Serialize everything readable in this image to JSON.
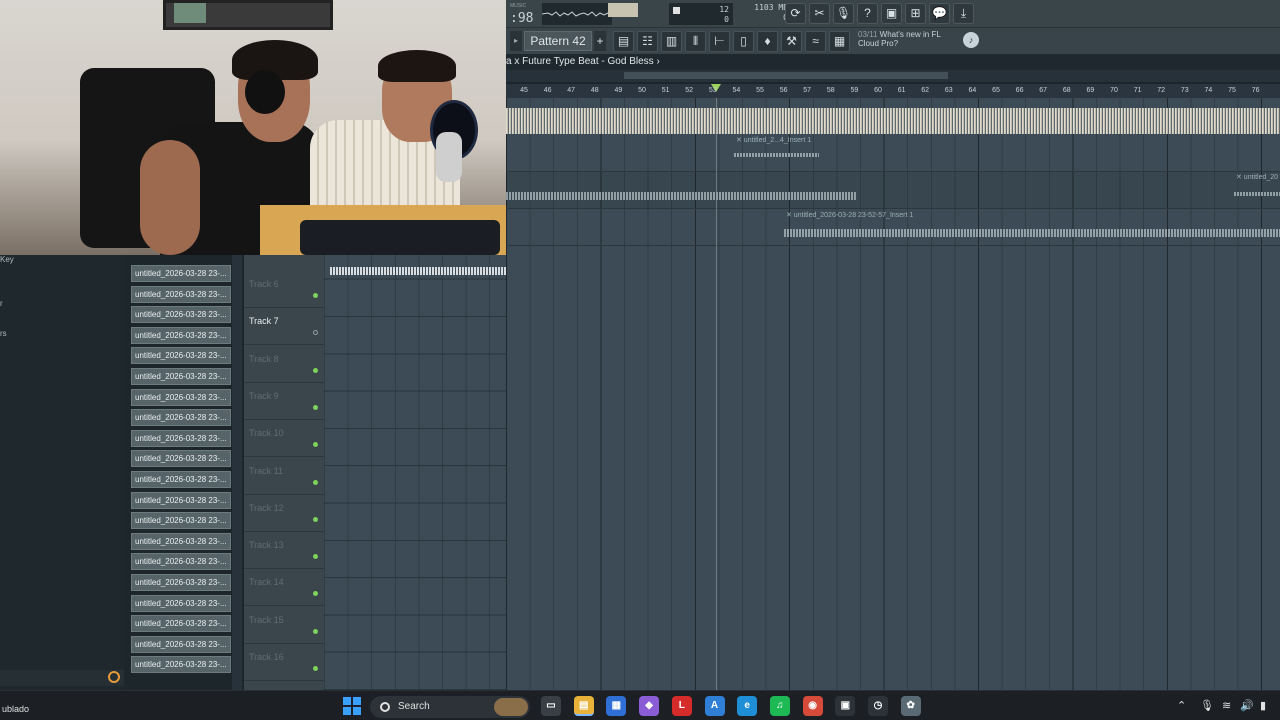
{
  "toolbar": {
    "tempo_label": "MUSIC",
    "tempo_value": ":98",
    "position_top": "12",
    "position_bottom": "0",
    "memory_top": "1103 MB",
    "memory_bottom": "0",
    "buttons": [
      {
        "icon": "loop-icon",
        "glyph": "⟳"
      },
      {
        "icon": "cut-icon",
        "glyph": "✂"
      },
      {
        "icon": "mic-icon",
        "glyph": "🎙"
      },
      {
        "icon": "help-icon",
        "glyph": "?"
      },
      {
        "icon": "save-icon",
        "glyph": "▣"
      },
      {
        "icon": "mixer-icon",
        "glyph": "⊞"
      },
      {
        "icon": "chat-icon",
        "glyph": "💬"
      },
      {
        "icon": "download-icon",
        "glyph": "⤓"
      }
    ]
  },
  "toolbar2": {
    "pattern_label": "Pattern 42",
    "add_glyph": "+",
    "play_glyph": "▸",
    "news_count": "03/11",
    "news_text_1": "What's new in FL",
    "news_text_2": "Cloud Pro?",
    "news_icon_glyph": "♪"
  },
  "playlist": {
    "title": "a x Future Type Beat - God Bless",
    "title_arrow": "›",
    "ruler_ticks": [
      "45",
      "46",
      "47",
      "48",
      "49",
      "50",
      "51",
      "52",
      "53",
      "54",
      "55",
      "56",
      "57",
      "58",
      "59",
      "60",
      "61",
      "62",
      "63",
      "64",
      "65",
      "66",
      "67",
      "68",
      "69",
      "70",
      "71",
      "72",
      "73",
      "74",
      "75",
      "76"
    ],
    "clip_labels": {
      "lane2": "✕ untitled_2...4_Insert 1",
      "lane3_right": "✕ untitled_20",
      "lane4": "✕ untitled_2026-03-28 23-52-57_Insert 1"
    }
  },
  "browser": {
    "labels": [
      "Key",
      "r",
      "rs"
    ],
    "search_icon": "search-icon"
  },
  "clip_list": {
    "items": [
      "untitled_2026-03-28 23-...",
      "untitled_2026-03-28 23-...",
      "untitled_2026-03-28 23-...",
      "untitled_2026-03-28 23-...",
      "untitled_2026-03-28 23-...",
      "untitled_2026-03-28 23-...",
      "untitled_2026-03-28 23-...",
      "untitled_2026-03-28 23-...",
      "untitled_2026-03-28 23-...",
      "untitled_2026-03-28 23-...",
      "untitled_2026-03-28 23-...",
      "untitled_2026-03-28 23-...",
      "untitled_2026-03-28 23-...",
      "untitled_2026-03-28 23-...",
      "untitled_2026-03-28 23-...",
      "untitled_2026-03-28 23-...",
      "untitled_2026-03-28 23-...",
      "untitled_2026-03-28 23-...",
      "untitled_2026-03-28 23-...",
      "untitled_2026-03-28 23-..."
    ]
  },
  "tracks": [
    {
      "name": "Track 6",
      "active": false,
      "led": "on"
    },
    {
      "name": "Track 7",
      "active": true,
      "led": "off"
    },
    {
      "name": "Track 8",
      "active": false,
      "led": "on"
    },
    {
      "name": "Track 9",
      "active": false,
      "led": "on"
    },
    {
      "name": "Track 10",
      "active": false,
      "led": "on"
    },
    {
      "name": "Track 11",
      "active": false,
      "led": "on"
    },
    {
      "name": "Track 12",
      "active": false,
      "led": "on"
    },
    {
      "name": "Track 13",
      "active": false,
      "led": "on"
    },
    {
      "name": "Track 14",
      "active": false,
      "led": "on"
    },
    {
      "name": "Track 15",
      "active": false,
      "led": "on"
    },
    {
      "name": "Track 16",
      "active": false,
      "led": "on"
    }
  ],
  "taskbar": {
    "subtitle": "ublado",
    "search_label": "Search",
    "apps": [
      {
        "icon": "task-view-icon",
        "glyph": "▭",
        "color": "#3a3f45"
      },
      {
        "icon": "file-explorer-icon",
        "glyph": "▤",
        "color": "#e8b23a"
      },
      {
        "icon": "store-icon",
        "glyph": "▦",
        "color": "#2f6fd6"
      },
      {
        "icon": "copilot-icon",
        "glyph": "◆",
        "color": "#8a5cd6"
      },
      {
        "icon": "acrobat-icon",
        "glyph": "L",
        "color": "#d62b2b"
      },
      {
        "icon": "arc-icon",
        "glyph": "A",
        "color": "#2f7fd6"
      },
      {
        "icon": "edge-icon",
        "glyph": "e",
        "color": "#1e8fd6"
      },
      {
        "icon": "spotify-icon",
        "glyph": "♫",
        "color": "#1db954"
      },
      {
        "icon": "chrome-icon",
        "glyph": "◉",
        "color": "#d64a3a"
      },
      {
        "icon": "window-icon",
        "glyph": "▣",
        "color": "#2d3238"
      },
      {
        "icon": "clock-app-icon",
        "glyph": "◷",
        "color": "#2d3238"
      },
      {
        "icon": "fl-studio-icon",
        "glyph": "✿",
        "color": "#5a6a74"
      }
    ],
    "tray": [
      {
        "icon": "chevron-up-icon",
        "glyph": "⌃"
      },
      {
        "icon": "mic-tray-icon",
        "glyph": "🎙"
      },
      {
        "icon": "wifi-icon",
        "glyph": "≋"
      },
      {
        "icon": "volume-icon",
        "glyph": "🔊"
      },
      {
        "icon": "battery-icon",
        "glyph": "▮"
      }
    ]
  }
}
